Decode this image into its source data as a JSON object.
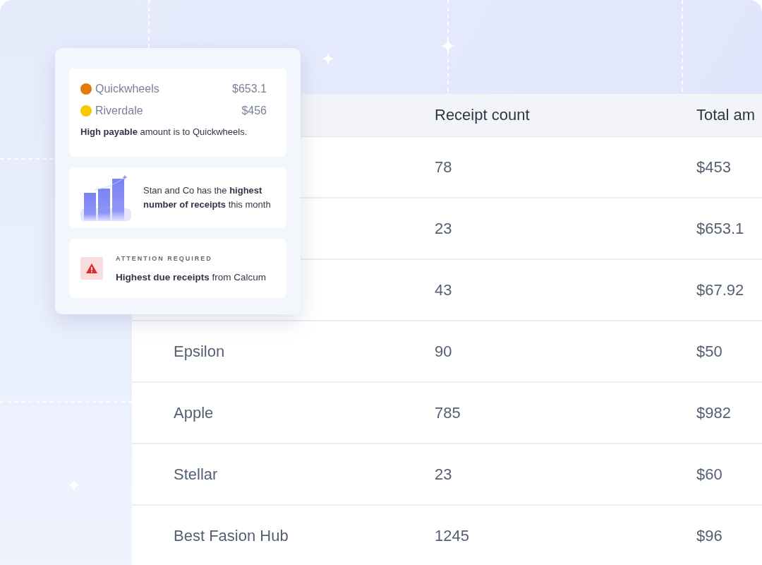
{
  "table": {
    "columns": [
      {
        "label": "Receipt count"
      },
      {
        "label": "Total am"
      }
    ],
    "rows": [
      {
        "count": "78",
        "total": "$453"
      },
      {
        "count": "23",
        "total": "$653.1"
      },
      {
        "count": "43",
        "total": "$67.92"
      },
      {
        "name": "Epsilon",
        "count": "90",
        "total": "$50"
      },
      {
        "name": "Apple",
        "count": "785",
        "total": "$982"
      },
      {
        "name": "Stellar",
        "count": "23",
        "total": "$60"
      },
      {
        "name": "Best Fasion Hub",
        "count": "1245",
        "total": "$96"
      }
    ]
  },
  "insights": {
    "payables": [
      {
        "name": "Quickwheels",
        "amount": "$653.1",
        "color": "#e07b0c"
      },
      {
        "name": "Riverdale",
        "amount": "$456",
        "color": "#f5c800"
      }
    ],
    "payable_note": "**High payable** amount is to Quickwheels.",
    "receipts_note": "Stan and Co has the **highest number of receipts** this month",
    "attention": {
      "label": "ATTENTION REQUIRED",
      "text": "**Highest due receipts** from Calcum"
    }
  }
}
